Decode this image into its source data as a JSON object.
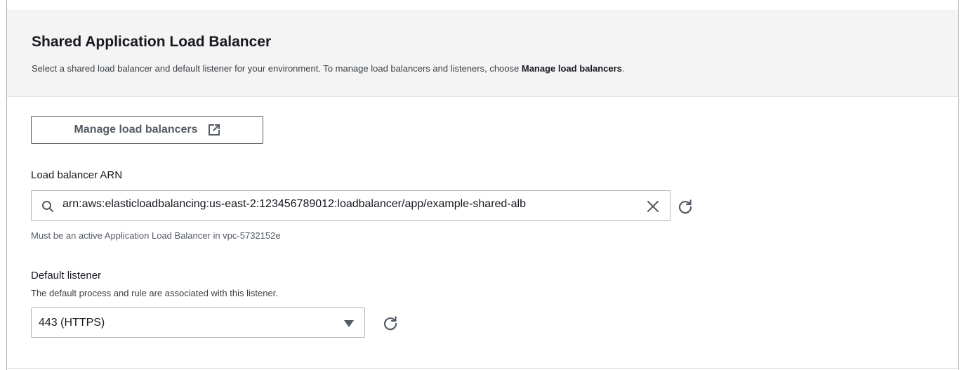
{
  "section": {
    "title": "Shared Application Load Balancer",
    "subtitle_text": "Select a shared load balancer and default listener for your environment. To manage load balancers and listeners, choose ",
    "subtitle_bold": "Manage load balancers",
    "subtitle_end": "."
  },
  "manage_button": {
    "label": "Manage load balancers",
    "icon": "external-link-icon"
  },
  "load_balancer_arn": {
    "label": "Load balancer ARN",
    "value": "arn:aws:elasticloadbalancing:us-east-2:123456789012:loadbalancer/app/example-shared-alb",
    "hint": "Must be an active Application Load Balancer in vpc-5732152e",
    "icons": [
      "search-icon",
      "clear-icon",
      "refresh-icon"
    ]
  },
  "default_listener": {
    "label": "Default listener",
    "description": "The default process and rule are associated with this listener.",
    "selected": "443 (HTTPS)",
    "icons": [
      "caret-down-icon",
      "refresh-icon"
    ]
  }
}
